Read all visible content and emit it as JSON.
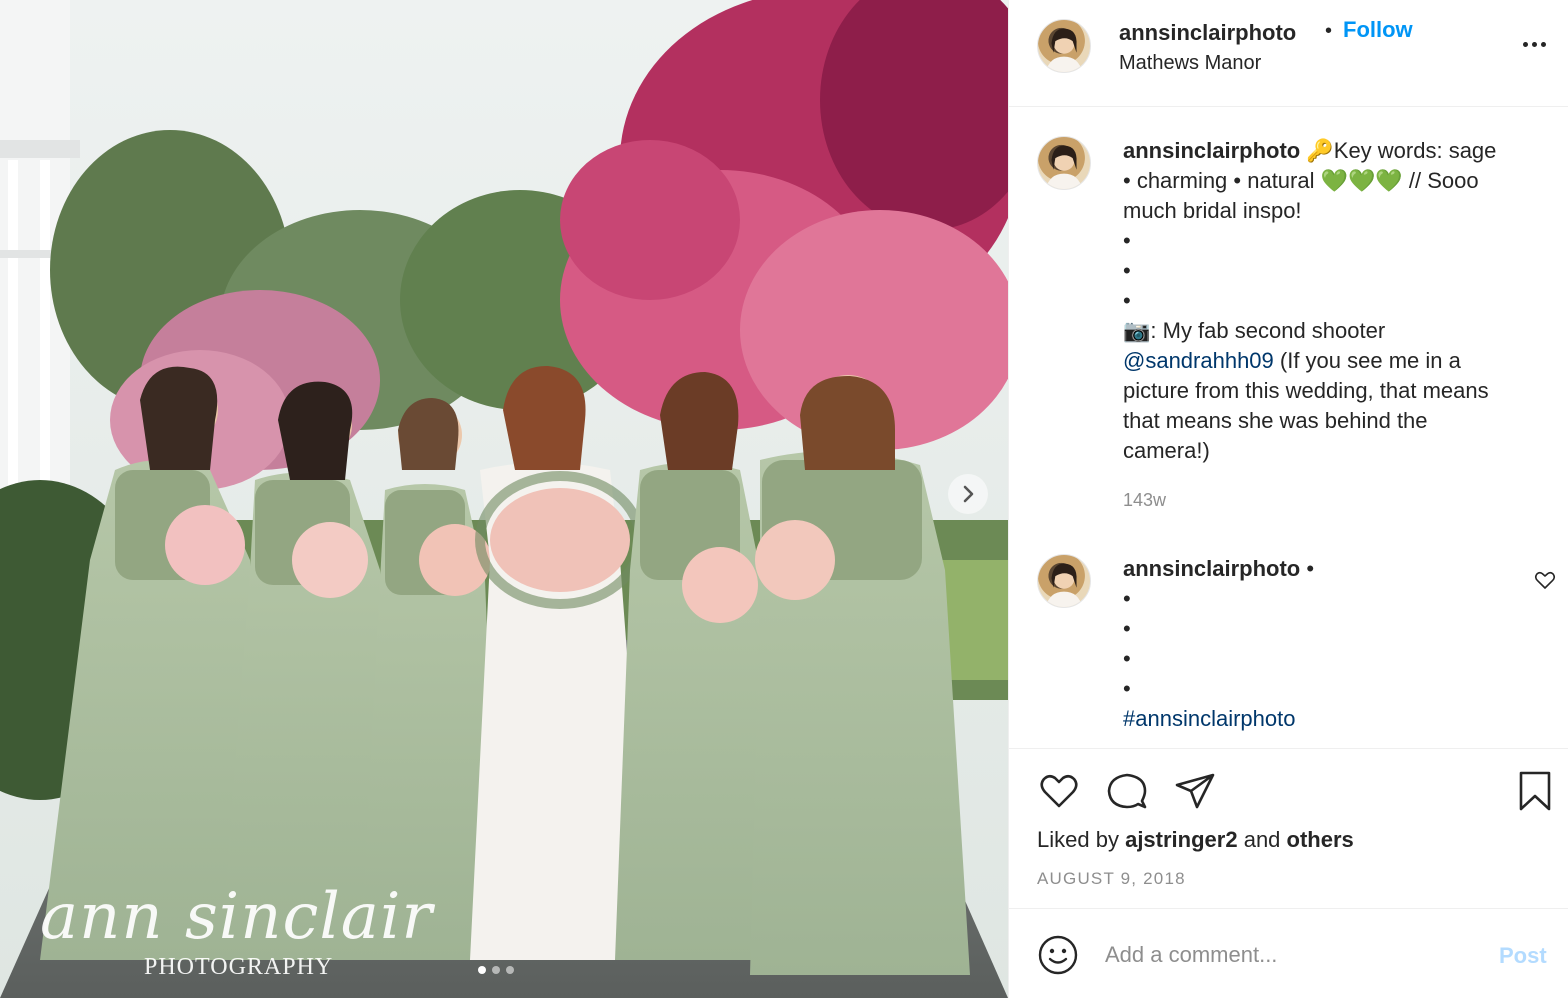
{
  "photo": {
    "watermark_script": "ann sinclair",
    "watermark_sub": "PHOTOGRAPHY",
    "next_icon": "chevron-right-icon",
    "carousel_total": 3,
    "carousel_active": 1
  },
  "header": {
    "username": "annsinclairphoto",
    "separator": "•",
    "follow_label": "Follow",
    "location": "Mathews Manor",
    "more_icon": "more-options-icon",
    "follow_color": "#0095f6"
  },
  "caption": {
    "username": "annsinclairphoto",
    "lines": [
      "🔑Key words: sage",
      "• charming • natural 💚💚💚 // Sooo",
      "much bridal inspo!",
      "•",
      "•",
      "•",
      "📷: My fab second shooter"
    ],
    "mention": "@sandrahhh09",
    "mention_rest": " (If you see me in a",
    "lines_after": [
      "picture from this wedding, that means",
      "that means she was behind the",
      "camera!)"
    ],
    "time": "143w"
  },
  "comment": {
    "username": "annsinclairphoto",
    "separator": "•",
    "lines": [
      "•",
      "•",
      "•",
      "•"
    ],
    "hashtag": "#annsinclairphoto",
    "like_icon": "heart-outline-icon"
  },
  "actions": {
    "like_icon": "heart-icon",
    "comment_icon": "comment-icon",
    "share_icon": "share-icon",
    "save_icon": "bookmark-icon",
    "liked_prefix": "Liked by",
    "liked_user": "ajstringer2",
    "liked_and": "and",
    "liked_others": "others",
    "date": "AUGUST 9, 2018"
  },
  "add_comment": {
    "emoji_icon": "smiley-icon",
    "placeholder": "Add a comment...",
    "post_label": "Post",
    "post_color": "#b3dbff"
  }
}
